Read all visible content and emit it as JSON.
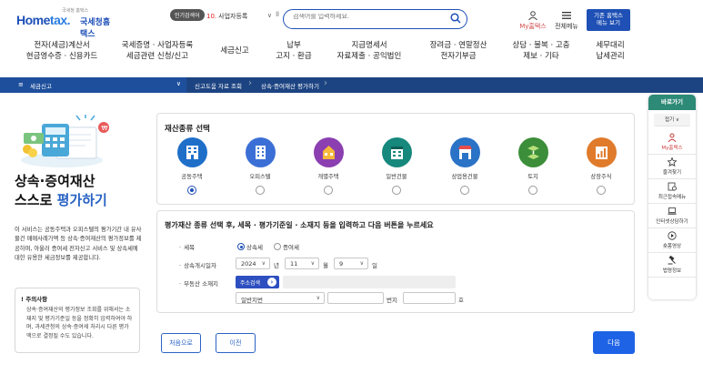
{
  "header": {
    "logo_small": "국세청 홈택스",
    "logo_main_a": "Home",
    "logo_main_b": "tax.",
    "logo_ko": "국세청홈택스",
    "popular_label": "인기검색어",
    "popular_rank": "10.",
    "popular_term": "사업자등록",
    "search_placeholder": "검색어를 입력하세요.",
    "my_hometax": "My홈택스",
    "all_menu": "전체메뉴",
    "basic_btn_line1": "기존 홈택스",
    "basic_btn_line2": "메뉴 보기"
  },
  "gnb": [
    {
      "l1": "전자(세금)계산서",
      "l2": "현금영수증 · 신용카드"
    },
    {
      "l1": "국세증명 · 사업자등록",
      "l2": "세금관련 신청/신고"
    },
    {
      "l1": "세금신고",
      "l2": ""
    },
    {
      "l1": "납부",
      "l2": "고지 · 환급"
    },
    {
      "l1": "지급명세서",
      "l2": "자료제출 · 공익법인"
    },
    {
      "l1": "장려금 · 연말정산",
      "l2": "전자기부금"
    },
    {
      "l1": "상담 · 불복 · 고충",
      "l2": "제보 · 기타"
    },
    {
      "l1": "세무대리",
      "l2": "납세관리"
    }
  ],
  "breadcrumb": {
    "home": "세금신고",
    "seg1": "신고도움 자료 조회",
    "seg2": "상속·증여재산 평가하기"
  },
  "intro": {
    "title_l1": "상속·증여재산",
    "title_l2a": "스스로 ",
    "title_l2b": "평가하기",
    "desc": "이 서비스는 공동주택과 오피스텔의 평가기간 내 유사물건 매매사례가액 등 상속·증여재산의 평가정보를 제공하며, 아울러 증여세 전자신고 서비스 및 상속세에 대한 유용한 세금정보를 제공합니다.",
    "notice_title": "! 주의사항",
    "notice_text": "상속·증여재산의 평가정보 조회를 위해서는 소재지 및 평가기준일 등을 정확히 입력하여야 하며, 과세관청의 상속·증여세 처리시 다른 평가액으로 결정될 수도 있습니다."
  },
  "property": {
    "title": "재산종류 선택",
    "types": [
      {
        "label": "공동주택",
        "color": "#1f6fc9",
        "selected": true,
        "icon": "apartment-icon"
      },
      {
        "label": "오피스텔",
        "color": "#3b6fd6",
        "selected": false,
        "icon": "office-icon"
      },
      {
        "label": "개별주택",
        "color": "#8b3fb0",
        "selected": false,
        "icon": "house-icon"
      },
      {
        "label": "일반건물",
        "color": "#16887c",
        "selected": false,
        "icon": "building-icon"
      },
      {
        "label": "상업용건물",
        "color": "#2b73c6",
        "selected": false,
        "icon": "commercial-icon"
      },
      {
        "label": "토지",
        "color": "#3c8e3a",
        "selected": false,
        "icon": "land-icon"
      },
      {
        "label": "상장주식",
        "color": "#e07b2b",
        "selected": false,
        "icon": "stock-icon"
      }
    ]
  },
  "form": {
    "title": "평가재산 종류 선택 후, 세목 · 평가기준일 · 소재지 등을 입력하고 다음 버튼을 누르세요",
    "tax_label": "세목",
    "tax_opt1": "상속세",
    "tax_opt2": "증여세",
    "date_label": "상속개시일자",
    "year": "2024",
    "year_unit": "년",
    "month": "11",
    "month_unit": "월",
    "day": "9",
    "day_unit": "일",
    "addr_label": "부동산 소재지",
    "addr_btn": "주소검색",
    "lot_type": "일반지번",
    "bunji_unit": "번지",
    "ho_unit": "호"
  },
  "buttons": {
    "first": "처음으로",
    "prev": "이전",
    "next": "다음"
  },
  "quick": {
    "title": "바로가기",
    "fold": "접기 ∨",
    "items": [
      {
        "label": "My홈택스",
        "red": true
      },
      {
        "label": "즐겨찾기"
      },
      {
        "label": "최근접속메뉴"
      },
      {
        "label": "인터넷상담하기"
      },
      {
        "label": "숏폼영상"
      },
      {
        "label": "법령정보"
      }
    ]
  }
}
